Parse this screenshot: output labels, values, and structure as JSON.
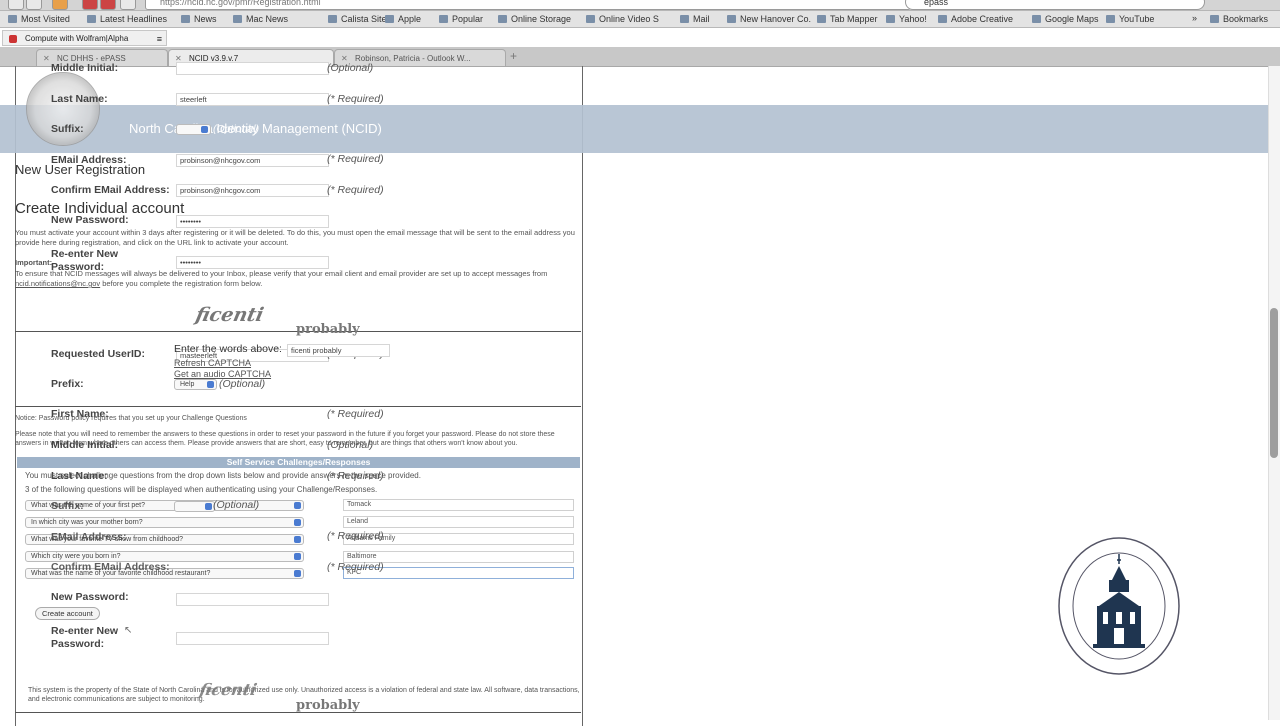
{
  "browser": {
    "url": "https://ncid.nc.gov/pmr/Registration.html",
    "search_value": "epass",
    "bookmarks": [
      "Most Visited",
      "Latest Headlines",
      "News",
      "Mac News",
      "Calista Sites",
      "Apple",
      "Popular",
      "Online Storage",
      "Online Video S",
      "Mail",
      "New Hanover Co.",
      "Tab Mapper",
      "Yahoo!",
      "Adobe Creative",
      "Google Maps",
      "YouTube"
    ],
    "bookmarks_overflow": "»",
    "bookmarks_menu": "Bookmarks",
    "side_tab": {
      "label": "Compute with Wolfram|Alpha",
      "menu": "≡"
    },
    "tabs": [
      "NC DHHS - ePASS",
      "NCID v3.9.v.7",
      "Robinson, Patricia - Outlook W..."
    ],
    "new_tab": "+"
  },
  "header": {
    "title": "North Carolina Identity Management (NCID)"
  },
  "page": {
    "new_user_heading": "New User Registration",
    "create_heading": "Create Individual account",
    "activation_note": "You must activate your account within 3 days after registering or it will be deleted. To do this, you must open the email message that will be sent to the email address you provide here during registration, and click on the URL link to activate your account.",
    "important_label": "Important:",
    "important_note_pre": "To ensure that NCID messages will always be delivered to your Inbox, please verify that your email client and email provider are set up to accept messages from ",
    "important_link": "ncid.notifications@nc.gov",
    "important_note_post": " before you complete the registration form below.",
    "requested_userid_label": "Requested UserID:",
    "requested_userid_value": "masteerleft",
    "prefix_label": "Prefix:",
    "prefix_value": "Help",
    "first_name_label": "First Name:",
    "middle_initial_label": "Middle Initial:",
    "last_name_label": "Last Name:",
    "last_name_value": "steerleft",
    "suffix_label": "Suffix:",
    "email_label": "EMail Address:",
    "email_value": "probinson@nhcgov.com",
    "confirm_email_label": "Confirm EMail Address:",
    "confirm_email_value": "probinson@nhcgov.com",
    "new_password_label": "New Password:",
    "password_mask": "••••••••",
    "reenter_label_1": "Re-enter New",
    "reenter_label_2": "Password:",
    "required": "(* Required)",
    "optional": "(Optional)",
    "captcha_word_1": "ficenti",
    "captcha_word_2": "probably",
    "captcha_prompt": "Enter the words above:",
    "captcha_value": "ficenti probably",
    "refresh_captcha": "Refresh CAPTCHA",
    "audio_captcha": "Get an audio CAPTCHA",
    "notice": "Notice: Password policy requires that you set up your Challenge Questions",
    "notice_detail": "Please note that you will need to remember the answers to these questions in order to reset your password in the future if you forget your password. Please do not store these answers in written form where others can access them. Please provide answers that are short, easy to remember, but are things that others won't know about you.",
    "selfservice_title": "Self Service Challenges/Responses",
    "selfservice_line1": "You must select challenge questions from the drop down lists below and provide answers in the space provided.",
    "selfservice_line2": "3 of the following questions will be displayed when authenticating using your Challenge/Responses.",
    "questions": [
      {
        "q": "What was the name of your first pet?",
        "a": "Tomack"
      },
      {
        "q": "In which city was your mother born?",
        "a": "Leland"
      },
      {
        "q": "What was your favorite TV show from childhood?",
        "a": "Addams Family"
      },
      {
        "q": "Which city were you born in?",
        "a": "Baltimore"
      },
      {
        "q": "What was the name of your favorite childhood restaurant?",
        "a": "KFC"
      }
    ],
    "create_button": "Create account",
    "footer": "This system is the property of the State of North Carolina and is for authorized use only. Unauthorized access is a violation of federal and state law. All software, data transactions, and electronic communications are subject to monitoring."
  },
  "colors": {
    "header_band": "#b3c1d1",
    "selfservice_bar": "#9fb3c9"
  }
}
